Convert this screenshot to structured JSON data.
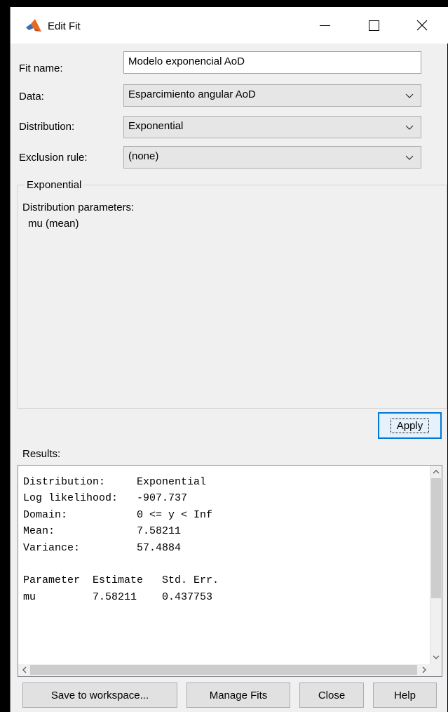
{
  "window": {
    "title": "Edit Fit"
  },
  "form": {
    "fit_name_label": "Fit name:",
    "fit_name_value": "Modelo exponencial AoD",
    "data_label": "Data:",
    "data_value": "Esparcimiento angular AoD",
    "distribution_label": "Distribution:",
    "distribution_value": "Exponential",
    "exclusion_label": "Exclusion rule:",
    "exclusion_value": "(none)"
  },
  "params": {
    "group_title": "Exponential",
    "heading": "Distribution parameters:",
    "items": [
      "mu (mean)"
    ]
  },
  "apply_label": "Apply",
  "results": {
    "label": "Results:",
    "lines": [
      "Distribution:     Exponential",
      "Log likelihood:   -907.737",
      "Domain:           0 <= y < Inf",
      "Mean:             7.58211",
      "Variance:         57.4884",
      "",
      "Parameter  Estimate   Std. Err.",
      "mu         7.58211    0.437753"
    ]
  },
  "buttons": {
    "save": "Save to workspace...",
    "manage": "Manage Fits",
    "close": "Close",
    "help": "Help"
  },
  "colors": {
    "accent": "#0078d7",
    "window_bg": "#f0f0f0"
  }
}
